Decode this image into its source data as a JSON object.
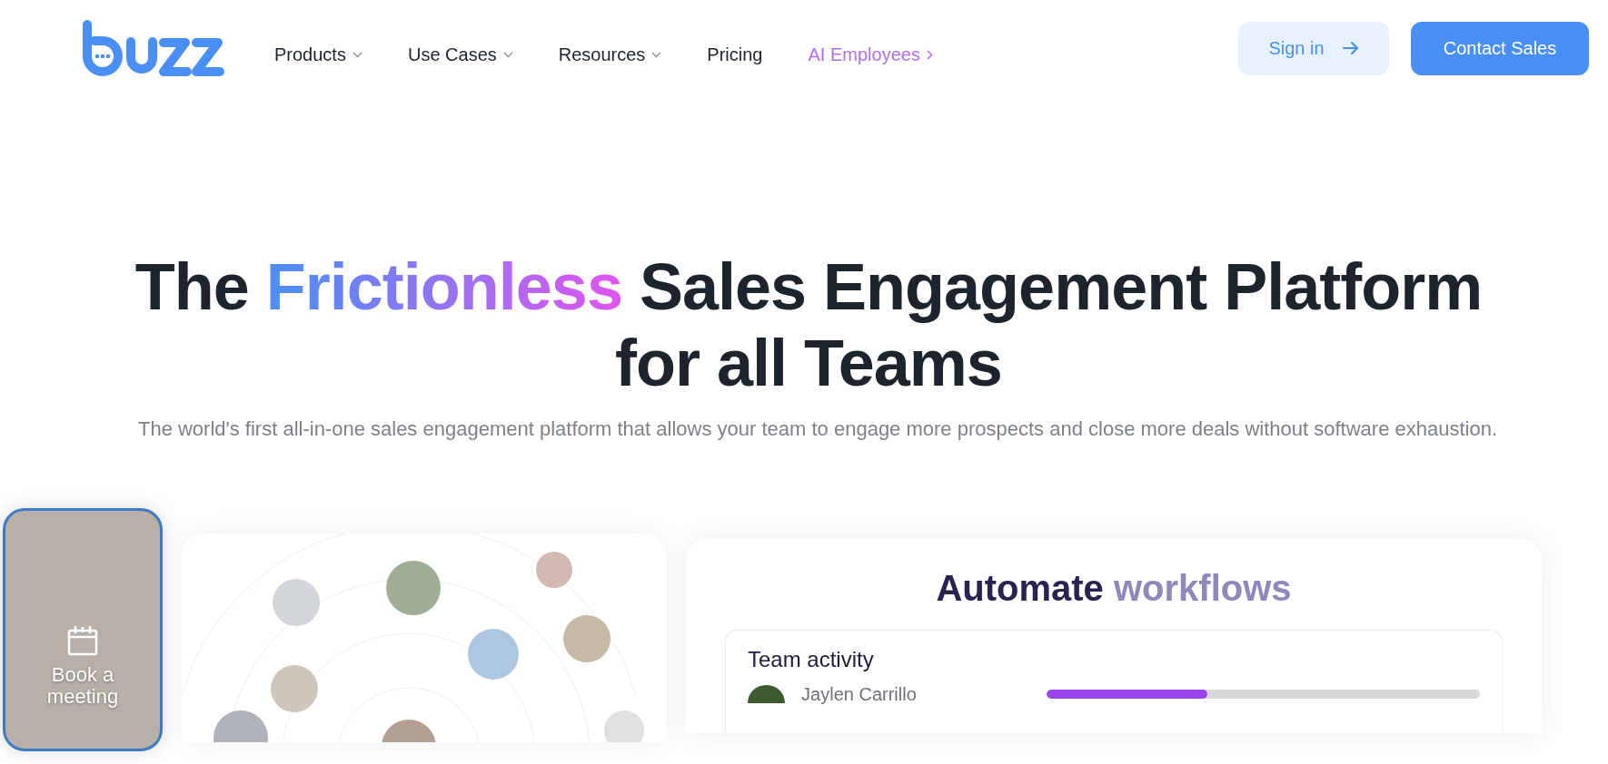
{
  "nav": {
    "items": [
      {
        "label": "Products",
        "kind": "dropdown"
      },
      {
        "label": "Use Cases",
        "kind": "dropdown"
      },
      {
        "label": "Resources",
        "kind": "dropdown"
      },
      {
        "label": "Pricing",
        "kind": "plain"
      },
      {
        "label": "AI Employees",
        "kind": "highlight"
      }
    ],
    "sign_in": "Sign in",
    "contact": "Contact Sales"
  },
  "hero": {
    "heading_before": "The",
    "heading_highlight": "Frictionless",
    "heading_after": "Sales Engagement Platform for all Teams",
    "subtitle": "The world's first all-in-one sales engagement platform that allows your team to engage more prospects and close more deals without software exhaustion."
  },
  "video_widget": {
    "label": "Book a meeting"
  },
  "workflow_card": {
    "title_dark": "Automate",
    "title_light": "workflows",
    "panel_title": "Team activity",
    "rows": [
      {
        "name": "Jaylen Carrillo",
        "level": 0.37
      }
    ]
  }
}
